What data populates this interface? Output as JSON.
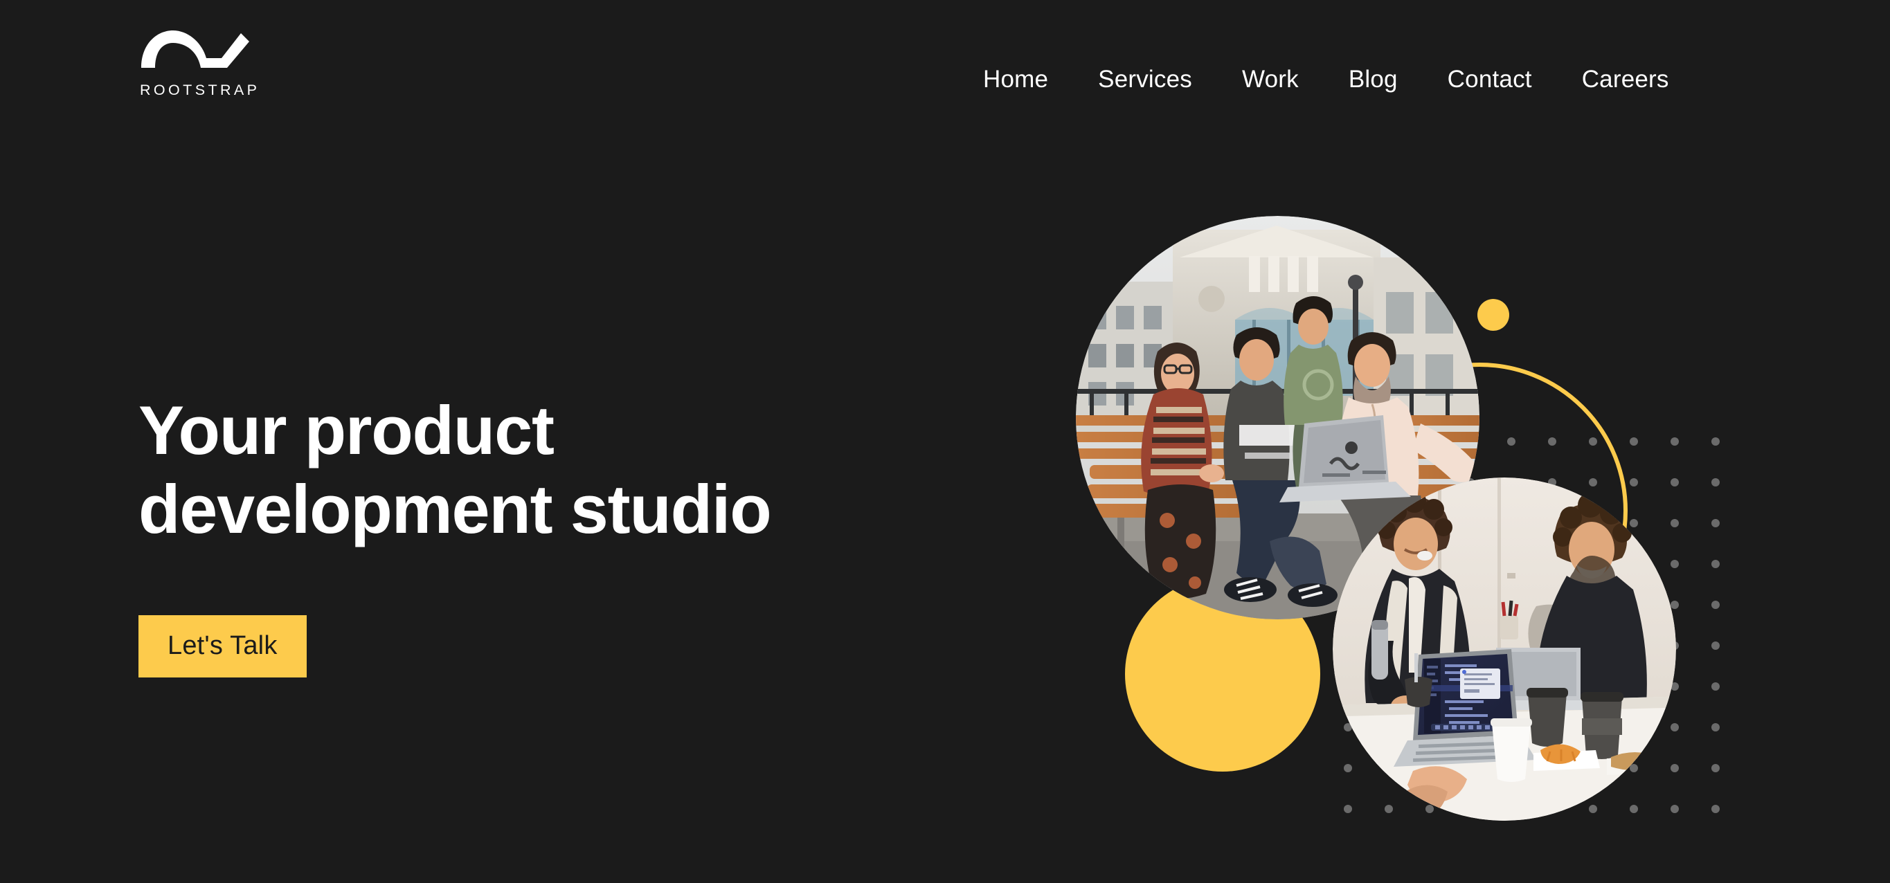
{
  "page": {
    "background_color": "#1b1b1b",
    "accent_color": "#fdcb4c",
    "text_color": "#ffffff"
  },
  "header": {
    "brand": {
      "logo_icon": "rootstrap-wave-check-logo",
      "wordmark": "ROOTSTRAP"
    },
    "nav": {
      "items": [
        {
          "label": "Home"
        },
        {
          "label": "Services"
        },
        {
          "label": "Work"
        },
        {
          "label": "Blog"
        },
        {
          "label": "Contact"
        },
        {
          "label": "Careers"
        }
      ]
    }
  },
  "hero": {
    "title": "Your product\ndevelopment studio",
    "cta": {
      "label": "Let's Talk",
      "background_color": "#fdcb4c",
      "text_color": "#1b1b1b"
    },
    "collage": {
      "photo_top": {
        "name": "team-on-bench-photo",
        "alt": "Four teammates sitting on a wooden city bench looking at a laptop"
      },
      "photo_bottom": {
        "name": "two-developers-at-desk-photo",
        "alt": "Two smiling developers working at a white desk with laptops and coffee cups"
      },
      "shapes": [
        {
          "name": "yellow-outline-circle",
          "color": "#fdcb4c"
        },
        {
          "name": "yellow-solid-circle",
          "color": "#fdcb4c"
        },
        {
          "name": "yellow-small-dot",
          "color": "#fdcb4c"
        },
        {
          "name": "gray-dot-grid",
          "color": "#6b6b6b",
          "columns": 10,
          "rows": 10,
          "spacing_px": 59
        }
      ]
    }
  }
}
